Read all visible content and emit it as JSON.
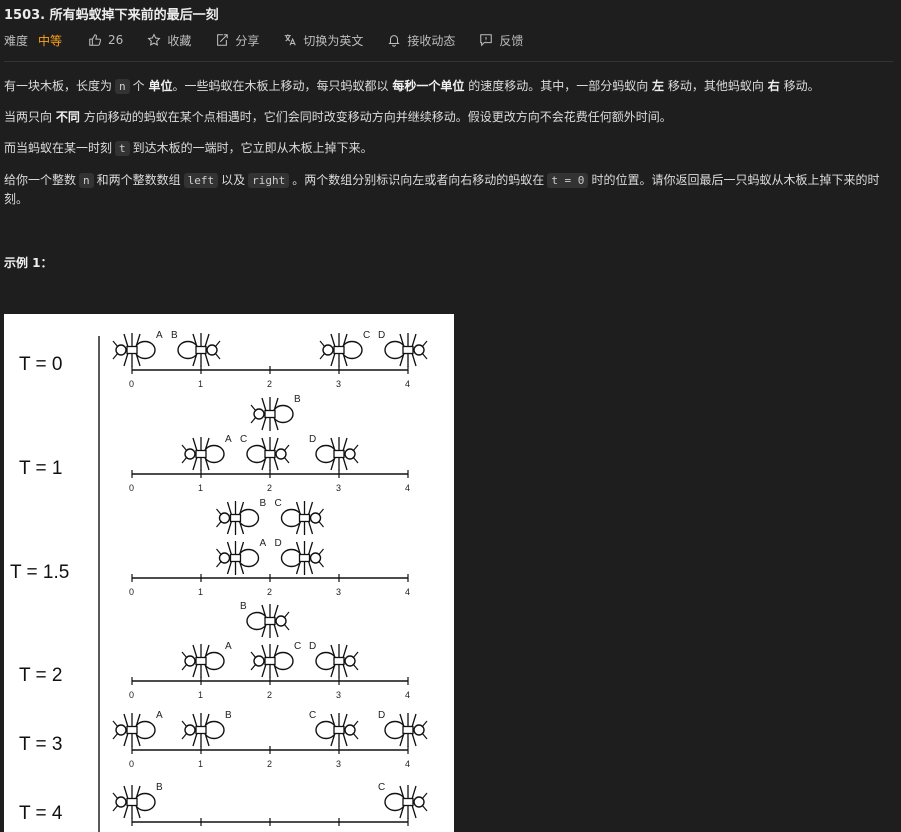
{
  "header": {
    "title": "1503. 所有蚂蚁掉下来前的最后一刻",
    "difficulty_label": "难度",
    "difficulty_value": "中等",
    "likes": "26",
    "favorite": "收藏",
    "share": "分享",
    "switch_lang": "切换为英文",
    "subscribe": "接收动态",
    "feedback": "反馈"
  },
  "description": {
    "p1": {
      "a": "有一块木板，长度为",
      "code1": "n",
      "b": "个",
      "bold1": "单位",
      "c": "。一些蚂蚁在木板上移动，每只蚂蚁都以",
      "bold2": "每秒一个单位",
      "d": "的速度移动。其中，一部分蚂蚁向",
      "bold3": "左",
      "e": "移动，其他蚂蚁向",
      "bold4": "右",
      "f": "移动。"
    },
    "p2": {
      "a": "当两只向",
      "bold1": "不同",
      "b": "方向移动的蚂蚁在某个点相遇时，它们会同时改变移动方向并继续移动。假设更改方向不会花费任何额外时间。"
    },
    "p3": {
      "a": "而当蚂蚁在某一时刻",
      "code1": "t",
      "b": "到达木板的一端时，它立即从木板上掉下来。"
    },
    "p4": {
      "a": "给你一个整数",
      "code1": "n",
      "b": "和两个整数数组",
      "code2": "left",
      "c": "以及",
      "code3": "right",
      "d": "。两个数组分别标识向左或者向右移动的蚂蚁在",
      "code4": "t = 0",
      "e": "时的位置。请你返回最后一只蚂蚁从木板上掉下来的时刻。"
    }
  },
  "example": {
    "title": "示例 1："
  },
  "figure": {
    "rows": [
      {
        "label": "T = 0",
        "ants": [
          {
            "pos": 0,
            "dir": "left",
            "name": "A"
          },
          {
            "pos": 1,
            "dir": "right",
            "name": "B"
          },
          {
            "pos": 3,
            "dir": "left",
            "name": "C"
          },
          {
            "pos": 4,
            "dir": "right",
            "name": "D"
          }
        ]
      },
      {
        "label": "T = 1",
        "ants": [
          {
            "pos": 1,
            "dir": "left",
            "name": "A"
          },
          {
            "pos": 2,
            "dir": "left",
            "name": "B",
            "lane": "upper"
          },
          {
            "pos": 2,
            "dir": "right",
            "name": "C"
          },
          {
            "pos": 3,
            "dir": "right",
            "name": "D"
          }
        ]
      },
      {
        "label": "T = 1.5",
        "ants": [
          {
            "pos": 1.5,
            "dir": "left",
            "name": "B",
            "lane": "upper"
          },
          {
            "pos": 2.5,
            "dir": "right",
            "name": "C",
            "lane": "upper"
          },
          {
            "pos": 1.5,
            "dir": "left",
            "name": "A"
          },
          {
            "pos": 2.5,
            "dir": "right",
            "name": "D"
          }
        ]
      },
      {
        "label": "T = 2",
        "ants": [
          {
            "pos": 2,
            "dir": "right",
            "name": "B",
            "lane": "upper"
          },
          {
            "pos": 1,
            "dir": "left",
            "name": "A"
          },
          {
            "pos": 2,
            "dir": "left",
            "name": "C"
          },
          {
            "pos": 3,
            "dir": "right",
            "name": "D"
          }
        ]
      },
      {
        "label": "T = 3",
        "ants": [
          {
            "pos": 0,
            "dir": "left",
            "name": "A"
          },
          {
            "pos": 1,
            "dir": "left",
            "name": "B"
          },
          {
            "pos": 3,
            "dir": "right",
            "name": "C"
          },
          {
            "pos": 4,
            "dir": "right",
            "name": "D"
          }
        ]
      },
      {
        "label": "T = 4",
        "ants": [
          {
            "pos": 0,
            "dir": "left",
            "name": "B"
          },
          {
            "pos": 4,
            "dir": "right",
            "name": "C"
          }
        ]
      }
    ],
    "ticks": [
      "0",
      "1",
      "2",
      "3",
      "4"
    ]
  }
}
